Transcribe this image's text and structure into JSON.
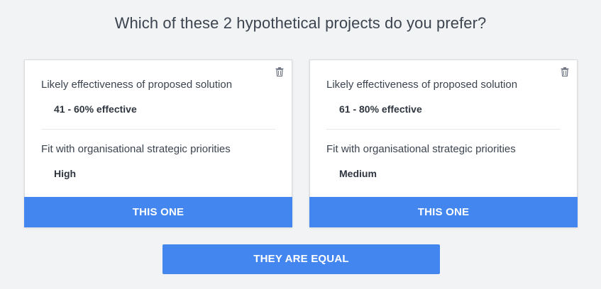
{
  "question": "Which of these 2 hypothetical projects do you prefer?",
  "options": [
    {
      "attributes": [
        {
          "label": "Likely effectiveness of proposed solution",
          "value": "41 - 60% effective"
        },
        {
          "label": "Fit with organisational strategic priorities",
          "value": "High"
        }
      ],
      "choose_label": "THIS ONE",
      "delete_icon": "trash-icon"
    },
    {
      "attributes": [
        {
          "label": "Likely effectiveness of proposed solution",
          "value": "61 - 80% effective"
        },
        {
          "label": "Fit with organisational strategic priorities",
          "value": "Medium"
        }
      ],
      "choose_label": "THIS ONE",
      "delete_icon": "trash-icon"
    }
  ],
  "equal_label": "THEY ARE EQUAL",
  "colors": {
    "background": "#f2f3f4",
    "accent": "#4486f0",
    "text": "#3c4450"
  }
}
